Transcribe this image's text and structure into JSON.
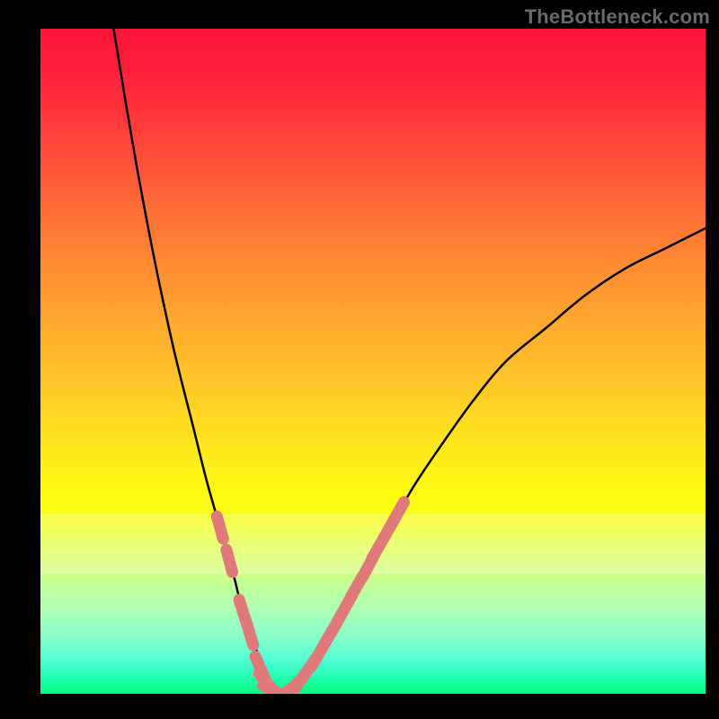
{
  "watermark": "TheBottleneck.com",
  "colors": {
    "curve": "#000000",
    "marker_fill": "#e07a7a",
    "marker_stroke": "#d46a6a",
    "band_overlay": "rgba(255,255,255,0.22)"
  },
  "chart_data": {
    "type": "line",
    "title": "",
    "xlabel": "",
    "ylabel": "",
    "xlim": [
      0,
      100
    ],
    "ylim": [
      0,
      100
    ],
    "series": [
      {
        "name": "left-branch",
        "x": [
          11,
          14,
          17,
          20,
          23,
          25,
          27,
          29,
          30,
          31,
          32,
          33,
          34,
          35,
          36
        ],
        "y": [
          100,
          82,
          66,
          52,
          40,
          32,
          25,
          18,
          14,
          11,
          8,
          5,
          3,
          1,
          0
        ]
      },
      {
        "name": "right-branch",
        "x": [
          36,
          38,
          40,
          42,
          45,
          48,
          52,
          56,
          60,
          65,
          70,
          76,
          82,
          88,
          94,
          100
        ],
        "y": [
          0,
          1,
          3,
          6,
          11,
          17,
          24,
          31,
          37,
          44,
          50,
          55,
          60,
          64,
          67,
          70
        ]
      }
    ],
    "markers_left": [
      {
        "x": 27,
        "y": 25
      },
      {
        "x": 28.4,
        "y": 20
      },
      {
        "x": 30.4,
        "y": 12.5
      },
      {
        "x": 31.5,
        "y": 9
      },
      {
        "x": 33,
        "y": 4
      },
      {
        "x": 34,
        "y": 1.7
      },
      {
        "x": 35,
        "y": 0.5
      },
      {
        "x": 36,
        "y": 0
      }
    ],
    "markers_right": [
      {
        "x": 37,
        "y": 0.3
      },
      {
        "x": 38,
        "y": 1
      },
      {
        "x": 39.3,
        "y": 2.3
      },
      {
        "x": 40.5,
        "y": 4
      },
      {
        "x": 41.6,
        "y": 5.6
      },
      {
        "x": 43,
        "y": 8
      },
      {
        "x": 44.5,
        "y": 10.6
      },
      {
        "x": 46,
        "y": 13.3
      },
      {
        "x": 47.6,
        "y": 16.2
      },
      {
        "x": 49.2,
        "y": 19
      },
      {
        "x": 50.8,
        "y": 22
      },
      {
        "x": 52.4,
        "y": 24.8
      },
      {
        "x": 53.8,
        "y": 27.3
      }
    ],
    "band": {
      "y0": 73,
      "y1": 82
    }
  }
}
